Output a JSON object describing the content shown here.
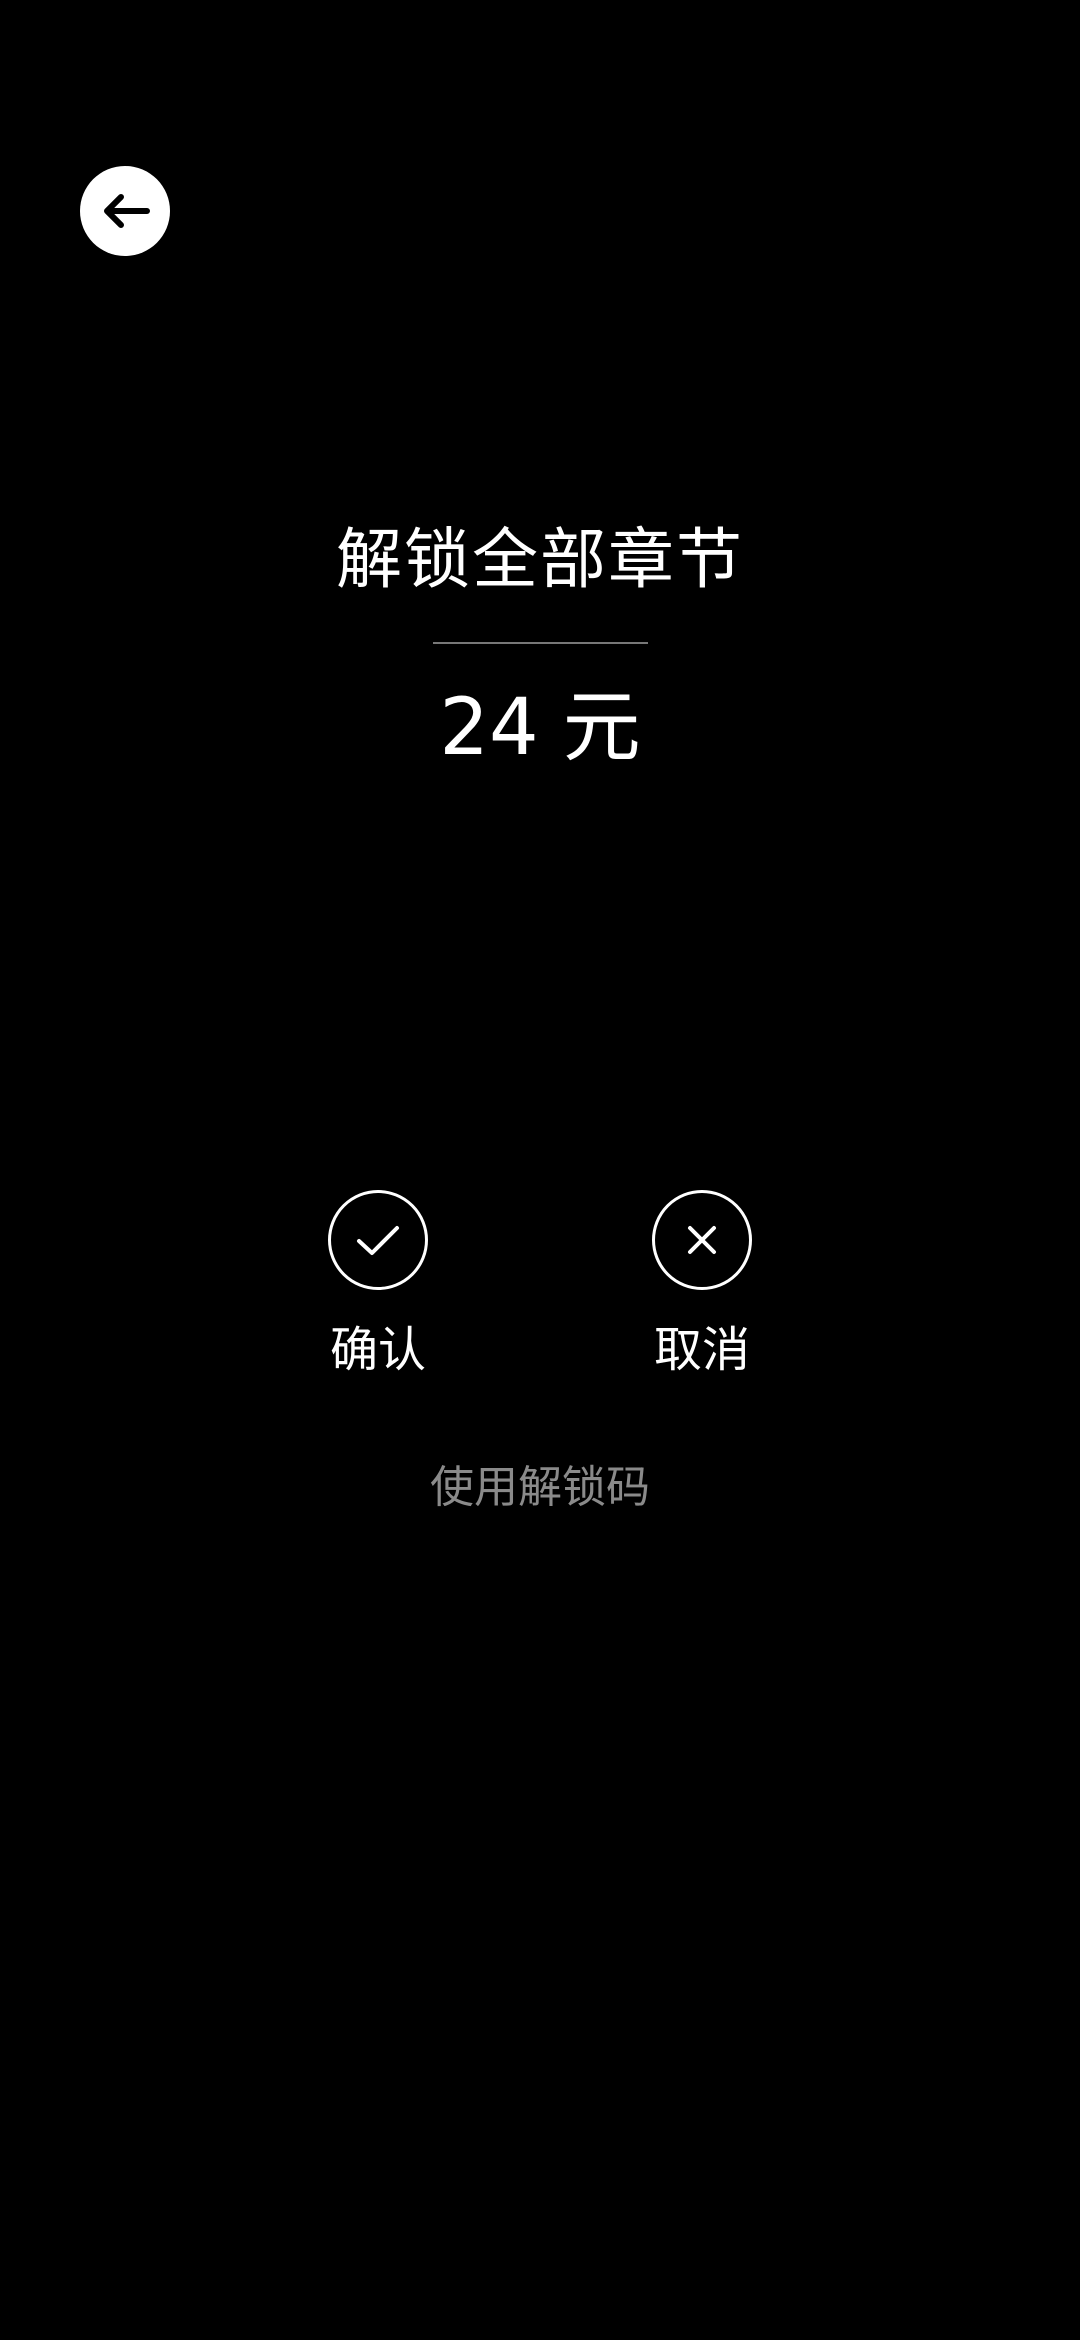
{
  "header": {
    "back_icon": "arrow-left-icon"
  },
  "main": {
    "title": "解锁全部章节",
    "price_amount": "24",
    "price_unit": "元"
  },
  "actions": {
    "confirm_label": "确认",
    "confirm_icon": "check-circle-icon",
    "cancel_label": "取消",
    "cancel_icon": "close-circle-icon"
  },
  "footer": {
    "unlock_code_link": "使用解锁码"
  },
  "colors": {
    "background": "#000000",
    "text": "#ffffff",
    "muted_text": "#8a8a8a",
    "divider": "#777777"
  }
}
